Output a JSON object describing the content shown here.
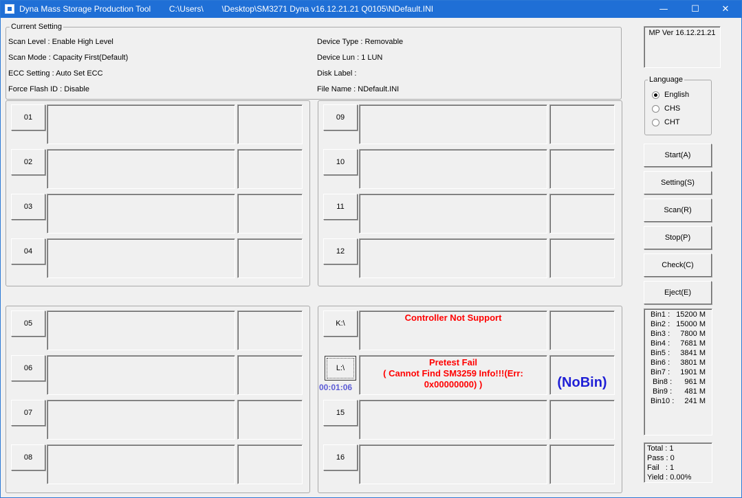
{
  "window": {
    "title": "Dyna Mass Storage Production Tool        C:\\Users\\        \\Desktop\\SM3271 Dyna v16.12.21.21 Q0105\\NDefault.INI",
    "minimize_glyph": "—",
    "maximize_glyph": "☐",
    "close_glyph": "✕"
  },
  "current_setting": {
    "label": "Current Setting",
    "scan_level": "Scan Level : Enable High Level",
    "scan_mode": "Scan Mode : Capacity First(Default)",
    "ecc_setting": "ECC Setting : Auto Set ECC",
    "force_flash_id": "Force Flash ID : Disable",
    "device_type": "Device Type : Removable",
    "device_lun": "Device Lun : 1 LUN",
    "disk_label": "Disk Label :",
    "file_name": "File Name : NDefault.INI"
  },
  "mp_version": "MP Ver 16.12.21.21",
  "language": {
    "label": "Language",
    "options": [
      "English",
      "CHS",
      "CHT"
    ],
    "selected": "English"
  },
  "actions": {
    "start": "Start(A)",
    "setting": "Setting(S)",
    "scan": "Scan(R)",
    "stop": "Stop(P)",
    "check": "Check(C)",
    "eject": "Eject(E)"
  },
  "ports": {
    "p01": "01",
    "p02": "02",
    "p03": "03",
    "p04": "04",
    "p05": "05",
    "p06": "06",
    "p07": "07",
    "p08": "08",
    "p09": "09",
    "p10": "10",
    "p11": "11",
    "p12": "12",
    "p13": "K:\\",
    "p14": "L:\\",
    "p15": "15",
    "p16": "16"
  },
  "port_status": {
    "p13_message": "Controller Not Support",
    "p14_message_line1": "Pretest Fail",
    "p14_message_line2": "( Cannot Find SM3259 Info!!!(Err:",
    "p14_message_line3": "0x00000000) )",
    "p14_result": "(NoBin)",
    "p14_timer": "00:01:06"
  },
  "bins": [
    {
      "name": "Bin1 :",
      "value": "15200 M"
    },
    {
      "name": "Bin2 :",
      "value": "15000 M"
    },
    {
      "name": "Bin3 :",
      "value": "7800 M"
    },
    {
      "name": "Bin4 :",
      "value": "7681 M"
    },
    {
      "name": "Bin5 :",
      "value": "3841 M"
    },
    {
      "name": "Bin6 :",
      "value": "3801 M"
    },
    {
      "name": "Bin7 :",
      "value": "1901 M"
    },
    {
      "name": "Bin8 :",
      "value": "961 M"
    },
    {
      "name": "Bin9 :",
      "value": "481 M"
    },
    {
      "name": "Bin10 :",
      "value": "241 M"
    }
  ],
  "stats": {
    "total": "Total : 1",
    "pass": "Pass : 0",
    "fail": "Fail   : 1",
    "yield": "Yield : 0.00%"
  },
  "colors": {
    "titlebar": "#1f6fd6",
    "error_text": "#ff0000",
    "nobin_text": "#1f1fd6",
    "timer_text": "#5b5bd6"
  }
}
